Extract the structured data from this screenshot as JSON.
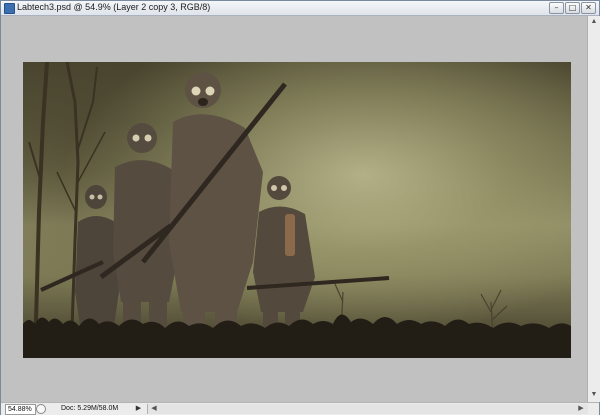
{
  "window": {
    "title": "Labtech3.psd @ 54.9% (Layer 2 copy 3, RGB/8)",
    "minimize_glyph": "–",
    "maximize_glyph": "□",
    "close_glyph": "✕"
  },
  "status": {
    "zoom": "54.88%",
    "doc_info": "Doc: 5.29M/58.0M",
    "menu_glyph": "▶"
  },
  "scroll": {
    "up": "▲",
    "down": "▼",
    "left": "◀",
    "right": "▶"
  },
  "artwork": {
    "description_icon": "soldiers-gas-masks-artwork"
  }
}
